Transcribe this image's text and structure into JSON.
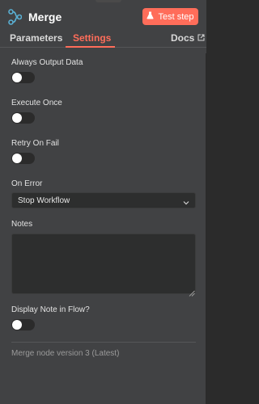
{
  "node": {
    "title": "Merge",
    "icon": "merge-icon",
    "test_button_label": "Test step",
    "accent_color": "#ff6d5a"
  },
  "tabs": [
    {
      "label": "Parameters",
      "active": false
    },
    {
      "label": "Settings",
      "active": true
    },
    {
      "label": "Docs",
      "active": false,
      "icon": "external-link-icon"
    }
  ],
  "settings": {
    "always_output_data": {
      "label": "Always Output Data",
      "enabled": false
    },
    "execute_once": {
      "label": "Execute Once",
      "enabled": false
    },
    "retry_on_fail": {
      "label": "Retry On Fail",
      "enabled": false
    },
    "on_error": {
      "label": "On Error",
      "value": "Stop Workflow"
    },
    "notes": {
      "label": "Notes",
      "value": ""
    },
    "display_note_in_flow": {
      "label": "Display Note in Flow?",
      "enabled": false
    }
  },
  "footer": {
    "version_text": "Merge node version 3 (Latest)"
  }
}
